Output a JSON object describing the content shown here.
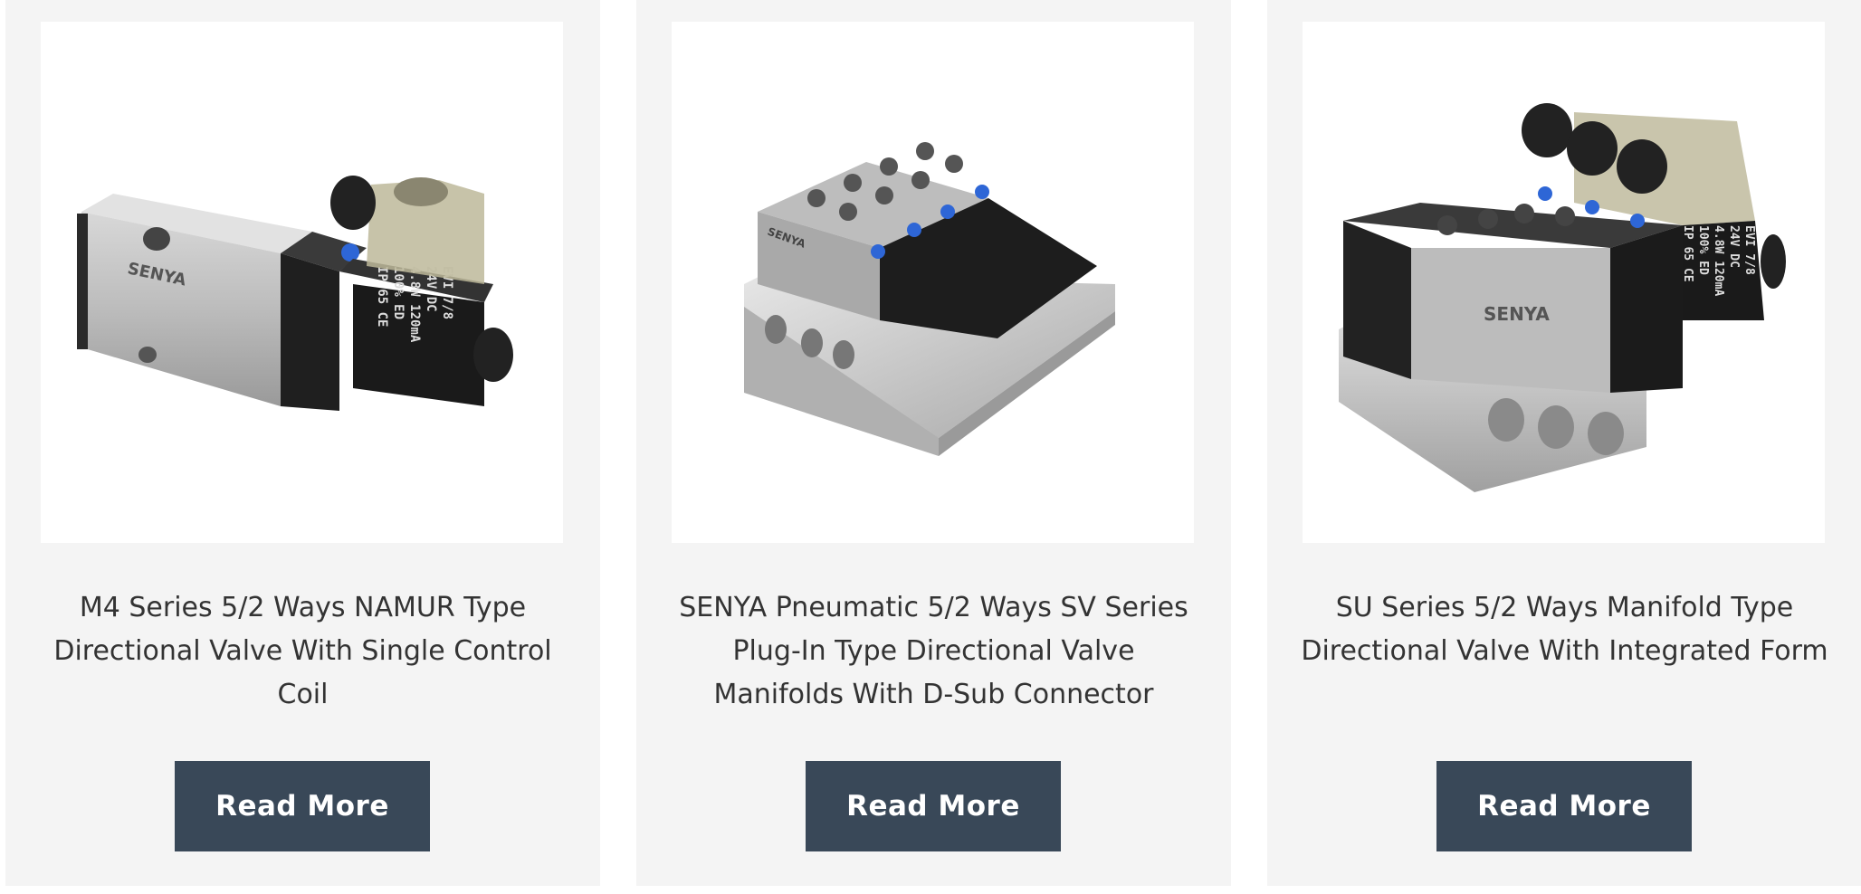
{
  "products": [
    {
      "title": "M4 Series 5/2 Ways NAMUR Type Directional Valve With Single Control Coil",
      "button_label": "Read More",
      "image_text": {
        "brand": "SENYA",
        "coil_lines": [
          "EVI 7/8",
          "24V DC",
          "4.8W 120mA",
          "100% ED",
          "IP 65 CE"
        ]
      }
    },
    {
      "title": "SENYA Pneumatic 5/2 Ways SV Series Plug-In Type Directional Valve Manifolds With D-Sub Connector",
      "button_label": "Read More",
      "image_text": {
        "brand": "SENYA"
      }
    },
    {
      "title": "SU Series 5/2 Ways Manifold Type Directional Valve With Integrated Form",
      "button_label": "Read More",
      "image_text": {
        "brand": "SENYA",
        "coil_lines": [
          "EVI 7/8",
          "24V DC",
          "4.8W 120mA",
          "100% ED",
          "IP 65 CE"
        ]
      }
    }
  ],
  "colors": {
    "card_background": "#f4f4f4",
    "button_background": "#394858",
    "button_text": "#ffffff",
    "title_text": "#333333"
  }
}
